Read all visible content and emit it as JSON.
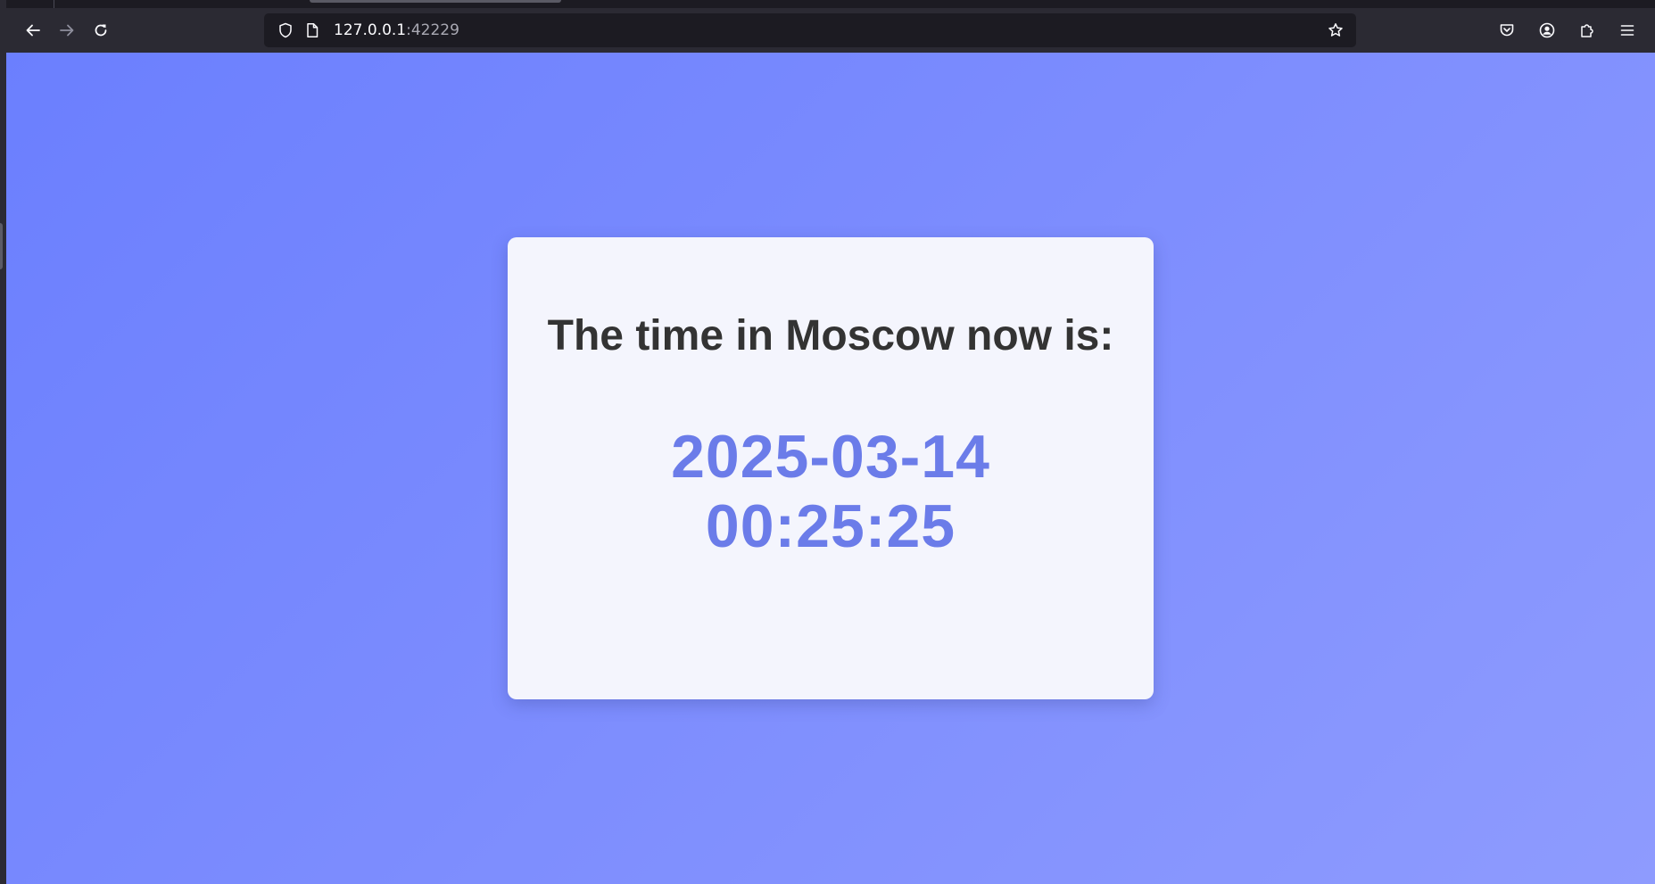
{
  "browser": {
    "url_host": "127.0.0.1",
    "url_port": ":42229"
  },
  "page": {
    "heading": "The time in Moscow now is:",
    "date": "2025-03-14",
    "time": "00:25:25"
  },
  "colors": {
    "background_start": "#6b7ffe",
    "background_end": "#8e9bfe",
    "card": "#f4f5fd",
    "heading_text": "#333333",
    "time_text": "#6b7ce9"
  }
}
